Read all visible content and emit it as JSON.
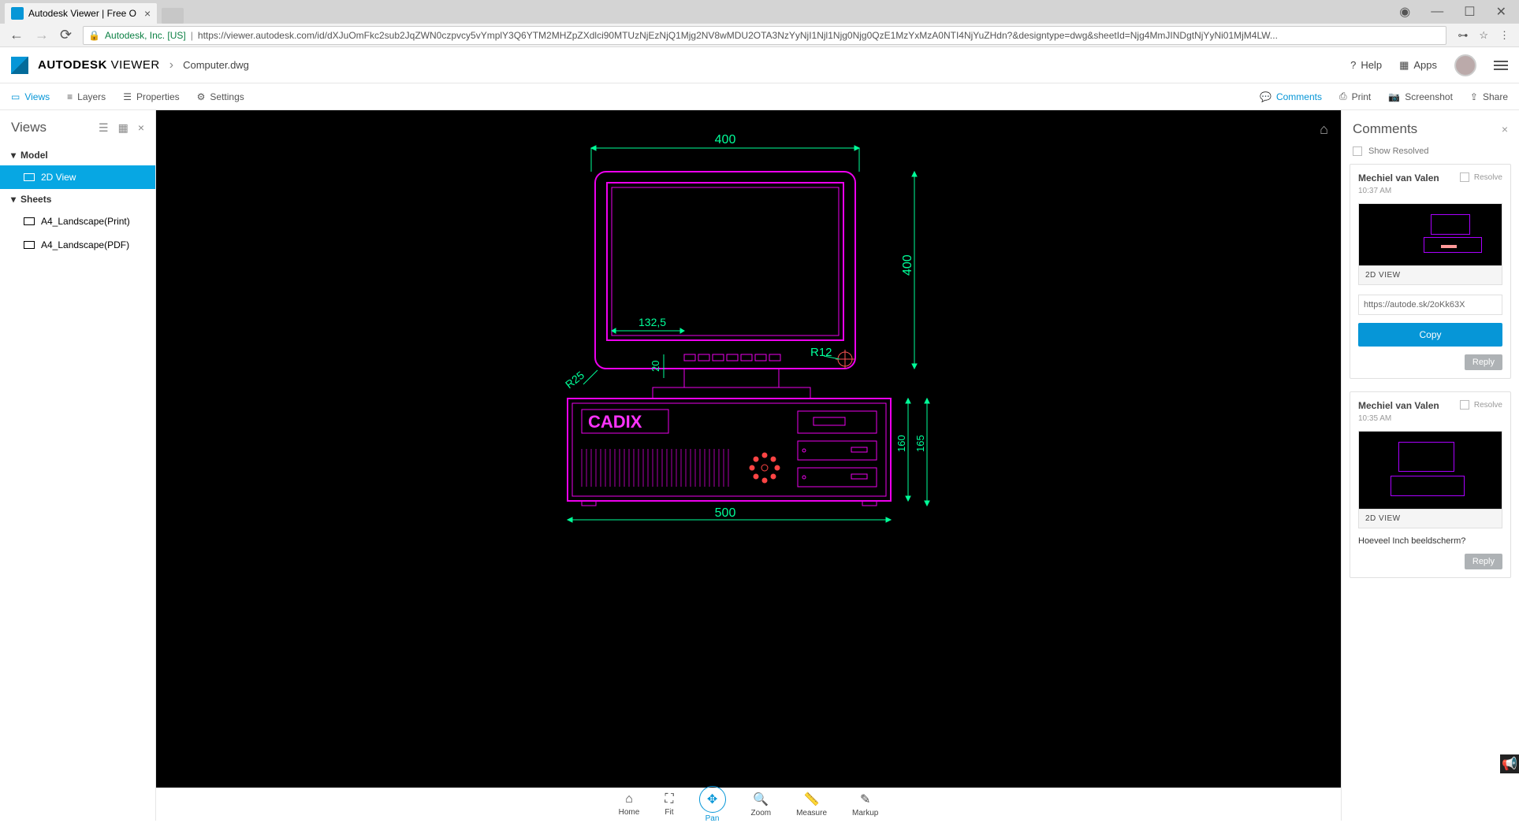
{
  "browser": {
    "tab_title": "Autodesk Viewer | Free O",
    "secure_label": "Autodesk, Inc. [US]",
    "url": "https://viewer.autodesk.com/id/dXJuOmFkc2sub2JqZWN0czpvcy5vYmplY3Q6YTM2MHZpZXdlci90MTUzNjEzNjQ1Mjg2NV8wMDU2OTA3NzYyNjI1Njl1Njg0Njg0QzE1MzYxMzA0NTI4NjYuZHdn?&designtype=dwg&sheetId=Njg4MmJINDgtNjYyNi01MjM4LW..."
  },
  "header": {
    "brand_bold": "AUTODESK",
    "brand_light": "VIEWER",
    "file": "Computer.dwg",
    "help": "Help",
    "apps": "Apps"
  },
  "toolbar": {
    "views": "Views",
    "layers": "Layers",
    "properties": "Properties",
    "settings": "Settings",
    "comments": "Comments",
    "print": "Print",
    "screenshot": "Screenshot",
    "share": "Share"
  },
  "views_panel": {
    "title": "Views",
    "group_model": "Model",
    "item_2d": "2D View",
    "group_sheets": "Sheets",
    "sheet_print": "A4_Landscape(Print)",
    "sheet_pdf": "A4_Landscape(PDF)"
  },
  "drawing": {
    "dim_top": "400",
    "dim_right": "400",
    "dim_bottom": "500",
    "dim_132": "132,5",
    "dim_20": "20",
    "dim_r12": "R12",
    "dim_r25": "R25",
    "dim_160": "160",
    "dim_165": "165",
    "brand_label": "CADIX"
  },
  "bottom_nav": {
    "home": "Home",
    "fit": "Fit",
    "pan": "Pan",
    "zoom": "Zoom",
    "measure": "Measure",
    "markup": "Markup"
  },
  "comments": {
    "title": "Comments",
    "show_resolved": "Show Resolved",
    "resolve": "Resolve",
    "reply": "Reply",
    "copy": "Copy",
    "view_caption": "2D VIEW",
    "thread1": {
      "author": "Mechiel van Valen",
      "time": "10:37 AM",
      "link": "https://autode.sk/2oKk63X"
    },
    "thread2": {
      "author": "Mechiel van Valen",
      "time": "10:35 AM",
      "body": "Hoeveel Inch beeldscherm?"
    }
  }
}
